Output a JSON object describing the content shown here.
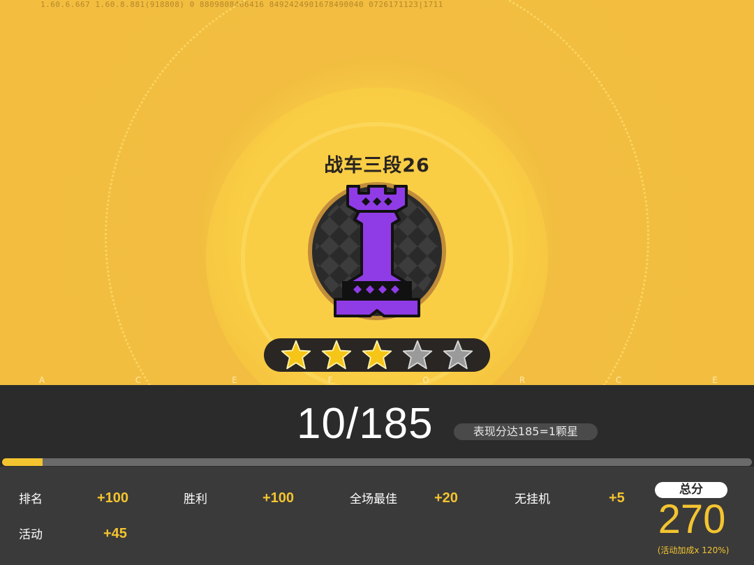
{
  "build_info": "1.60.6.667  1.60.8.881(918808)  0  8809808466416  8492424901678490040  0726171123|1711",
  "rank": {
    "title": "战车三段26",
    "piece_icon": "rook-icon"
  },
  "stars": {
    "filled": 3,
    "total": 5,
    "filled_color": "#f5c518",
    "empty_color": "#9a9a9a"
  },
  "letters": [
    "A",
    "C",
    "E",
    "F",
    "O",
    "R",
    "C",
    "E"
  ],
  "progress": {
    "text": "10/185",
    "current": 10,
    "max": 185,
    "note": "表现分达185=1颗星"
  },
  "stats": [
    {
      "label": "排名",
      "value": "+100"
    },
    {
      "label": "胜利",
      "value": "+100"
    },
    {
      "label": "全场最佳",
      "value": "+20"
    },
    {
      "label": "无挂机",
      "value": "+5"
    },
    {
      "label": "活动",
      "value": "+45"
    }
  ],
  "total": {
    "label": "总分",
    "value": "270",
    "note": "(活动加成x 120%)"
  },
  "colors": {
    "accent": "#f4c430",
    "background_top": "#f2bd40",
    "panel": "#3a3a3a",
    "piece": "#8f3ce6"
  }
}
